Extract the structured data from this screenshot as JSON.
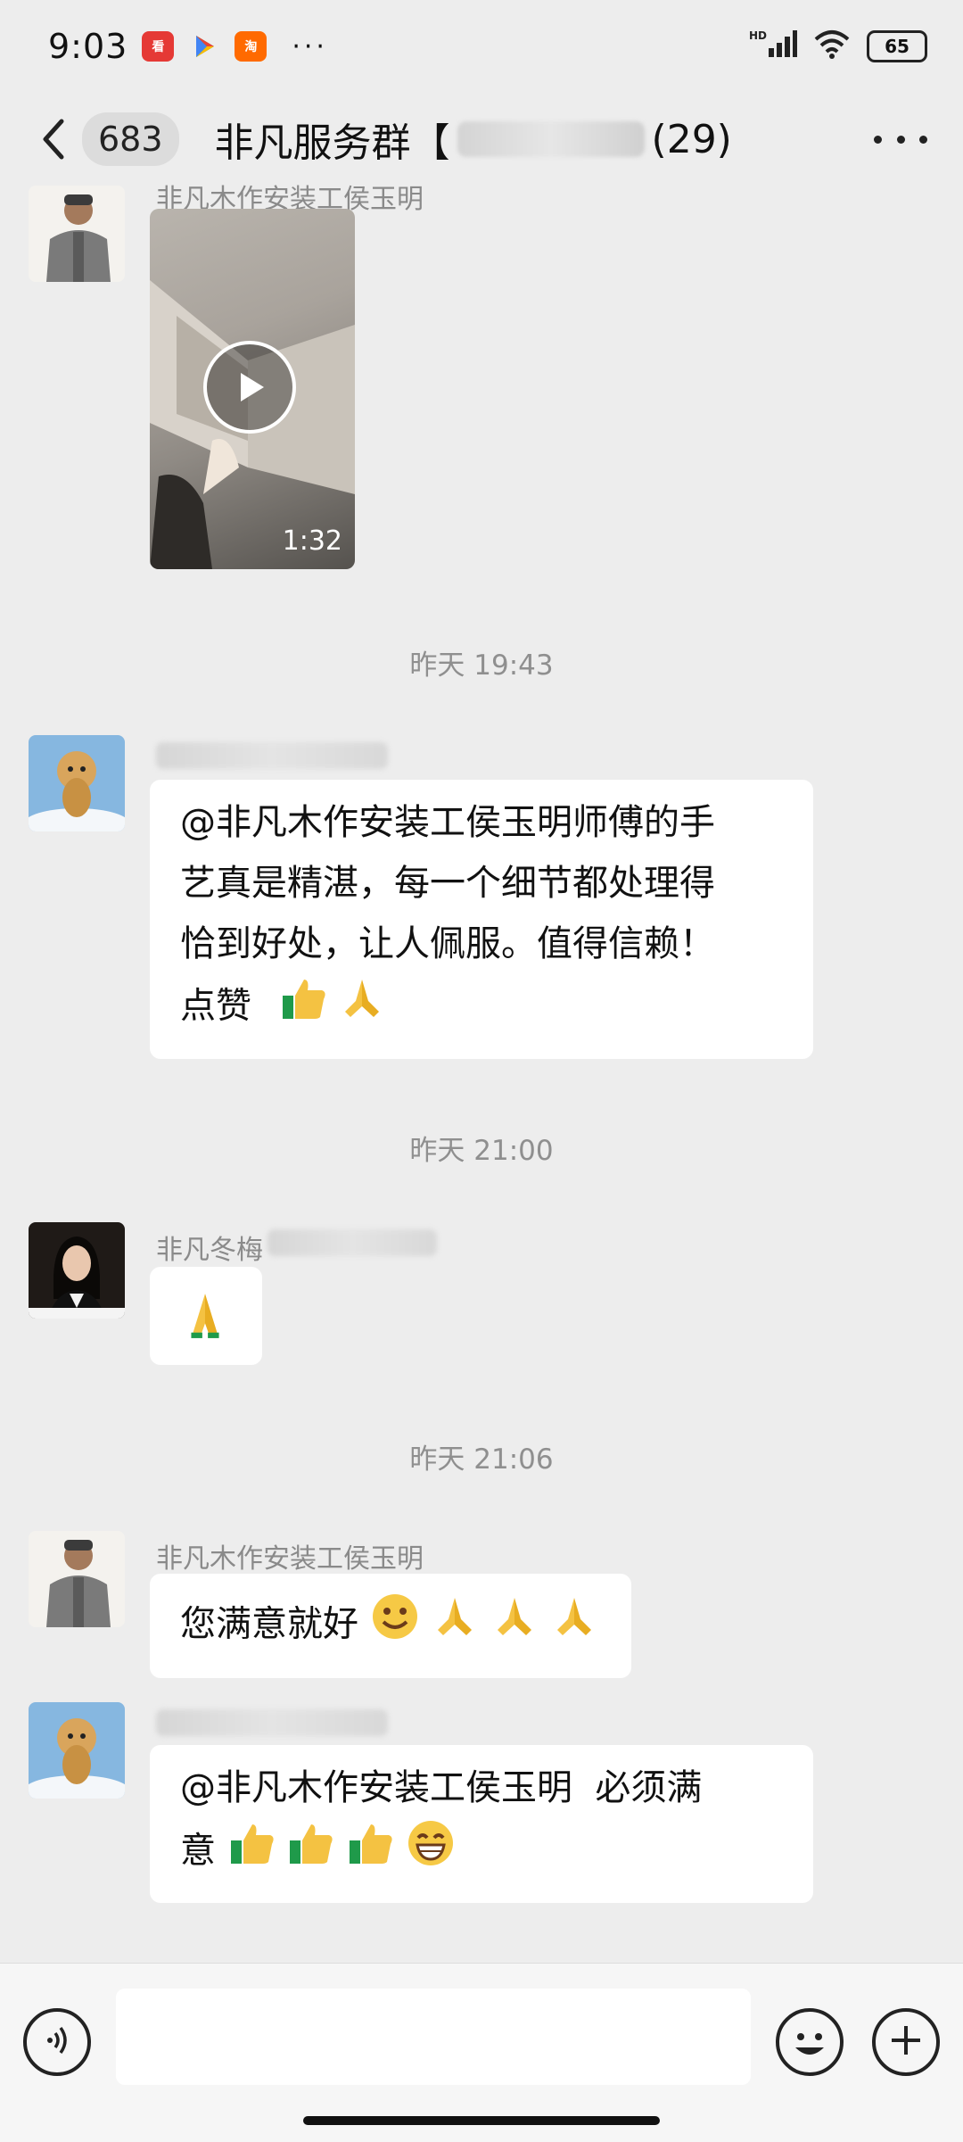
{
  "status_bar": {
    "time": "9:03",
    "app_icons": [
      "red-news-icon",
      "play-store-icon",
      "orange-shop-icon"
    ],
    "more": "···",
    "network": "HD",
    "battery": "65"
  },
  "header": {
    "unread_count": "683",
    "title_prefix": "非凡服务群【",
    "title_suffix": "(29)",
    "more_icon": "more-icon"
  },
  "messages": [
    {
      "type": "video",
      "sender": "非凡木作安装工侯玉明",
      "duration": "1:32"
    },
    {
      "type": "timestamp",
      "text": "昨天 19:43"
    },
    {
      "type": "text",
      "sender": "",
      "lines": [
        "@非凡木作安装工侯玉明师傅的手",
        "艺真是精湛，每一个细节都处理得",
        "恰到好处，让人佩服。值得信赖！",
        "点赞"
      ],
      "emojis": [
        "thumbs-up",
        "pray"
      ]
    },
    {
      "type": "timestamp",
      "text": "昨天 21:00"
    },
    {
      "type": "text",
      "sender": "非凡冬梅",
      "emojis": [
        "pray"
      ]
    },
    {
      "type": "timestamp",
      "text": "昨天 21:06"
    },
    {
      "type": "text",
      "sender": "非凡木作安装工侯玉明",
      "text": "您满意就好",
      "emojis": [
        "smile",
        "pray",
        "pray",
        "pray"
      ]
    },
    {
      "type": "text",
      "sender": "",
      "lines": [
        "@非凡木作安装工侯玉明  必须满",
        "意"
      ],
      "emojis": [
        "thumbs-up",
        "thumbs-up",
        "thumbs-up",
        "grin"
      ]
    }
  ],
  "input_bar": {
    "placeholder": ""
  }
}
